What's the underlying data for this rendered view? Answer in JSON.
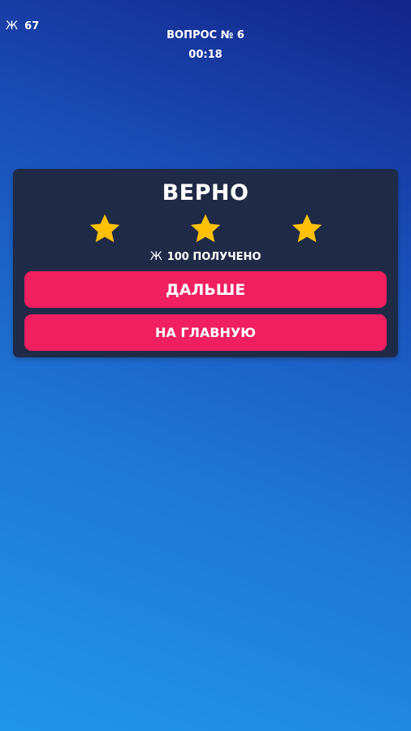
{
  "hud": {
    "coin_glyph": "Ж",
    "coins": "67",
    "question_label": "ВОПРОС № 6",
    "timer": "00:18"
  },
  "result": {
    "title": "ВЕРНО",
    "stars_earned": 3,
    "stars_total": 3,
    "star_color": "#ffc107",
    "reward_glyph": "Ж",
    "reward_text": "100 ПОЛУЧЕНО"
  },
  "buttons": {
    "next_label": "ДАЛЬШЕ",
    "home_label": "НА ГЛАВНУЮ",
    "color": "#f01f60"
  }
}
